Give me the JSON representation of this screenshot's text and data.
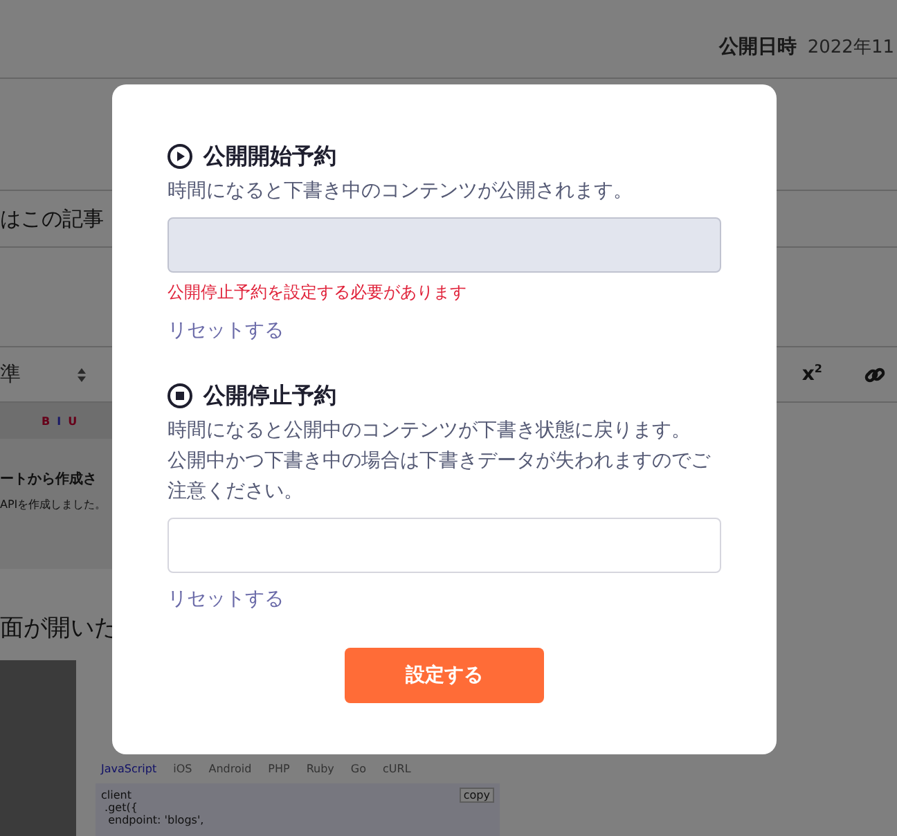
{
  "background": {
    "publish_label": "公開日時",
    "publish_date": "2022年11",
    "title_field": "はこの記事",
    "toolbar": {
      "format": "準",
      "superscript": "x$^{2}$"
    },
    "editor_image": {
      "toolbar_marks": [
        "B",
        "I",
        "U"
      ],
      "heading": "ートから作成さ",
      "text": "APIを作成しました。"
    },
    "paragraph": "面が開いた",
    "code_sample": {
      "tabs": [
        {
          "label": "JavaScript",
          "selected": true
        },
        {
          "label": "iOS",
          "selected": false
        },
        {
          "label": "Android",
          "selected": false
        },
        {
          "label": "PHP",
          "selected": false
        },
        {
          "label": "Ruby",
          "selected": false
        },
        {
          "label": "Go",
          "selected": false
        },
        {
          "label": "cURL",
          "selected": false
        }
      ],
      "copy": "copy",
      "lines": [
        "client",
        " .get({",
        "  endpoint: 'blogs',"
      ]
    }
  },
  "modal": {
    "sections": [
      {
        "kind": "start",
        "title": "公開開始予約",
        "description": [
          "時間になると下書き中のコンテンツが公開されます。"
        ],
        "field": {
          "disabled": true
        },
        "error": "公開停止予約を設定する必要があります",
        "reset": "リセットする"
      },
      {
        "kind": "stop",
        "title": "公開停止予約",
        "description": [
          "時間になると公開中のコンテンツが下書き状態に戻ります。",
          "公開中かつ下書き中の場合は下書きデータが失われますのでご注意ください。"
        ],
        "field": {
          "disabled": false
        },
        "reset": "リセットする"
      }
    ],
    "submit": "設定する"
  }
}
